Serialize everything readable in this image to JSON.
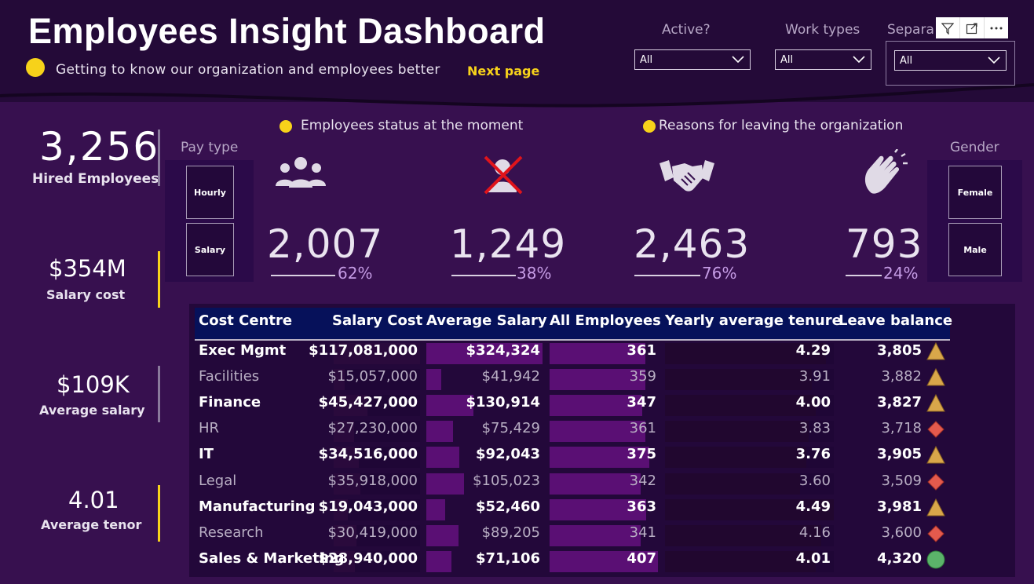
{
  "header": {
    "title": "Employees Insight Dashboard",
    "subtitle": "Getting to know our organization and employees better",
    "next_page": "Next page"
  },
  "slicers": {
    "active": {
      "label": "Active?",
      "value": "All"
    },
    "work_types": {
      "label": "Work types",
      "value": "All"
    },
    "separation": {
      "label": "Separa",
      "value": "All"
    }
  },
  "kpis": {
    "hired": {
      "value": "3,256",
      "label": "Hired Employees"
    },
    "salary_cost": {
      "value": "$354M",
      "label": "Salary cost"
    },
    "avg_salary": {
      "value": "$109K",
      "label": "Average salary"
    },
    "avg_tenor": {
      "value": "4.01",
      "label": "Average tenor"
    }
  },
  "pay_type": {
    "label": "Pay type",
    "options": [
      "Hourly",
      "Salary"
    ]
  },
  "gender": {
    "label": "Gender",
    "options": [
      "Female",
      "Male"
    ]
  },
  "status": {
    "title": "Employees status at the moment",
    "active": {
      "value": "2,007",
      "pct": "62%",
      "pct_num": 0.62,
      "icon": "group-icon"
    },
    "inactive": {
      "value": "1,249",
      "pct": "38%",
      "pct_num": 0.38,
      "icon": "crossed-person-icon"
    }
  },
  "reasons": {
    "title": "Reasons for leaving the organization",
    "handshake": {
      "value": "2,463",
      "pct": "76%",
      "pct_num": 0.76,
      "icon": "handshake-icon"
    },
    "clap": {
      "value": "793",
      "pct": "24%",
      "pct_num": 0.24,
      "icon": "clapping-hands-icon"
    }
  },
  "colors": {
    "background": "#37104f",
    "header": "#240a38",
    "accent_yellow": "#f7d21a",
    "bar_purple": "#5a0f74",
    "table_header": "#06115a",
    "kpi_yellow_bar": "#f7d21a",
    "kpi_grey_bar": "#8a7a9c"
  },
  "table": {
    "columns": [
      "Cost Centre",
      "Salary Cost",
      "Average Salary",
      "All Employees",
      "Yearly average tenure",
      "Leave balance"
    ],
    "rows": [
      {
        "cc": "Exec Mgmt",
        "salary_cost": "$117,081,000",
        "avg_salary": "$324,324",
        "employees": "361",
        "tenure": "4.29",
        "leave": "3,805",
        "indicator": "triangle",
        "sc_num": 117081000,
        "as_num": 324324,
        "emp_num": 361,
        "ten_num": 4.29
      },
      {
        "cc": "Facilities",
        "salary_cost": "$15,057,000",
        "avg_salary": "$41,942",
        "employees": "359",
        "tenure": "3.91",
        "leave": "3,882",
        "indicator": "triangle",
        "sc_num": 15057000,
        "as_num": 41942,
        "emp_num": 359,
        "ten_num": 3.91
      },
      {
        "cc": "Finance",
        "salary_cost": "$45,427,000",
        "avg_salary": "$130,914",
        "employees": "347",
        "tenure": "4.00",
        "leave": "3,827",
        "indicator": "triangle",
        "sc_num": 45427000,
        "as_num": 130914,
        "emp_num": 347,
        "ten_num": 4.0
      },
      {
        "cc": "HR",
        "salary_cost": "$27,230,000",
        "avg_salary": "$75,429",
        "employees": "361",
        "tenure": "3.83",
        "leave": "3,718",
        "indicator": "diamond",
        "sc_num": 27230000,
        "as_num": 75429,
        "emp_num": 361,
        "ten_num": 3.83
      },
      {
        "cc": "IT",
        "salary_cost": "$34,516,000",
        "avg_salary": "$92,043",
        "employees": "375",
        "tenure": "3.76",
        "leave": "3,905",
        "indicator": "triangle",
        "sc_num": 34516000,
        "as_num": 92043,
        "emp_num": 375,
        "ten_num": 3.76
      },
      {
        "cc": "Legal",
        "salary_cost": "$35,918,000",
        "avg_salary": "$105,023",
        "employees": "342",
        "tenure": "3.60",
        "leave": "3,509",
        "indicator": "diamond",
        "sc_num": 35918000,
        "as_num": 105023,
        "emp_num": 342,
        "ten_num": 3.6
      },
      {
        "cc": "Manufacturing",
        "salary_cost": "$19,043,000",
        "avg_salary": "$52,460",
        "employees": "363",
        "tenure": "4.49",
        "leave": "3,981",
        "indicator": "triangle",
        "sc_num": 19043000,
        "as_num": 52460,
        "emp_num": 363,
        "ten_num": 4.49
      },
      {
        "cc": "Research",
        "salary_cost": "$30,419,000",
        "avg_salary": "$89,205",
        "employees": "341",
        "tenure": "4.16",
        "leave": "3,600",
        "indicator": "diamond",
        "sc_num": 30419000,
        "as_num": 89205,
        "emp_num": 341,
        "ten_num": 4.16
      },
      {
        "cc": "Sales & Marketing",
        "salary_cost": "$28,940,000",
        "avg_salary": "$71,106",
        "employees": "407",
        "tenure": "4.01",
        "leave": "4,320",
        "indicator": "circle",
        "sc_num": 28940000,
        "as_num": 71106,
        "emp_num": 407,
        "ten_num": 4.01
      }
    ]
  }
}
